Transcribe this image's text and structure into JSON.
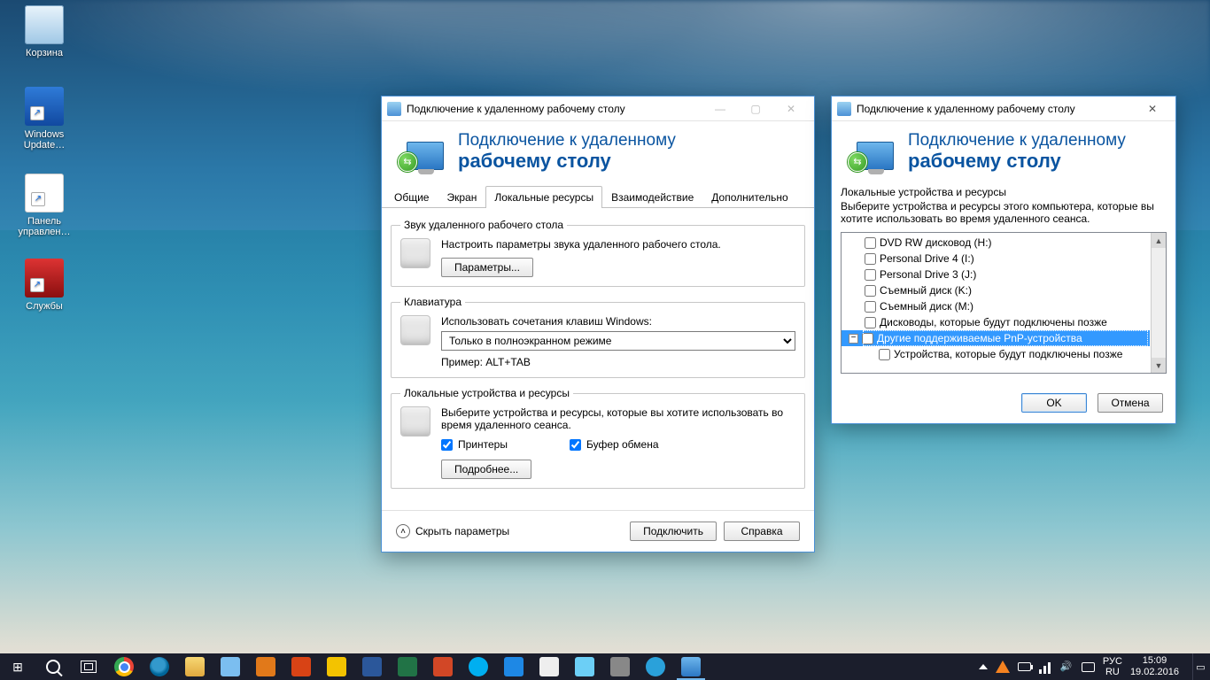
{
  "desktop_icons": {
    "recycle": "Корзина",
    "winupdate": "Windows Update…",
    "ctrlpanel": "Панель управлен…",
    "services": "Службы"
  },
  "main_window": {
    "title": "Подключение к удаленному рабочему столу",
    "banner_l1": "Подключение к удаленному",
    "banner_l2": "рабочему столу",
    "tabs": {
      "general": "Общие",
      "display": "Экран",
      "local": "Локальные ресурсы",
      "experience": "Взаимодействие",
      "advanced": "Дополнительно"
    },
    "sound": {
      "legend": "Звук удаленного рабочего стола",
      "text": "Настроить параметры звука удаленного рабочего стола.",
      "button": "Параметры..."
    },
    "keyboard": {
      "legend": "Клавиатура",
      "text": "Использовать сочетания клавиш Windows:",
      "option": "Только в полноэкранном режиме",
      "hint": "Пример: ALT+TAB"
    },
    "devices": {
      "legend": "Локальные устройства и ресурсы",
      "text": "Выберите устройства и ресурсы, которые вы хотите использовать во время удаленного сеанса.",
      "printers": "Принтеры",
      "clipboard": "Буфер обмена",
      "more": "Подробнее..."
    },
    "footer": {
      "hide": "Скрыть параметры",
      "connect": "Подключить",
      "help": "Справка"
    }
  },
  "devices_window": {
    "title": "Подключение к удаленному рабочему столу",
    "banner_l1": "Подключение к удаленному",
    "banner_l2": "рабочему столу",
    "group": "Локальные устройства и ресурсы",
    "instr": "Выберите устройства и ресурсы этого компьютера, которые вы хотите использовать во время удаленного сеанса.",
    "items": {
      "dvd": "DVD RW дисковод (H:)",
      "pd4": "Personal Drive 4 (I:)",
      "pd3": "Personal Drive 3 (J:)",
      "rk": "Съемный диск (K:)",
      "rm": "Съемный диск (M:)",
      "future_disks": "Дисководы, которые будут подключены позже",
      "pnp": "Другие поддерживаемые PnP-устройства",
      "future_dev": "Устройства, которые будут подключены позже"
    },
    "ok": "OK",
    "cancel": "Отмена"
  },
  "systray": {
    "kb": "РУС",
    "lang": "RU",
    "time": "15:09",
    "date": "19.02.2016"
  }
}
